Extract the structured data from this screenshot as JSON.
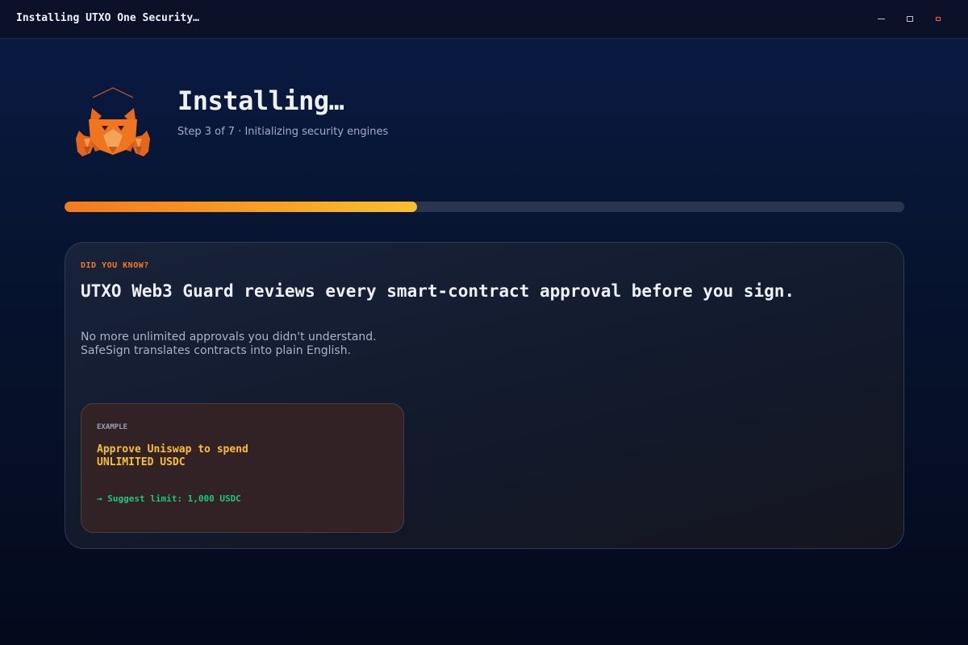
{
  "window": {
    "title": "Installing UTXO One Security…",
    "controls": {
      "minimize_icon": "minimize-icon",
      "maximize_icon": "maximize-icon",
      "close_icon": "close-icon"
    }
  },
  "header": {
    "logo_icon": "fox-logo-icon",
    "title": "Installing…",
    "subtitle": "Step 3 of 7 · Initializing security engines"
  },
  "progress": {
    "value": 0.42
  },
  "tip_card": {
    "eyebrow": "DID YOU KNOW?",
    "headline": "UTXO Web3 Guard reviews every smart-contract approval before you sign.",
    "body_line1": "No more unlimited approvals you didn't understand.",
    "body_line2": "SafeSign translates contracts into plain English.",
    "example": {
      "label": "EXAMPLE",
      "line1": "Approve Uniswap to spend",
      "line2": "UNLIMITED USDC",
      "suggestion": "→ Suggest limit: 1,000 USDC"
    }
  },
  "colors": {
    "accent_orange": "#f27a22",
    "accent_yellow": "#f9c02e",
    "success_green": "#22c37a",
    "close_red": "#ff5a4a"
  }
}
